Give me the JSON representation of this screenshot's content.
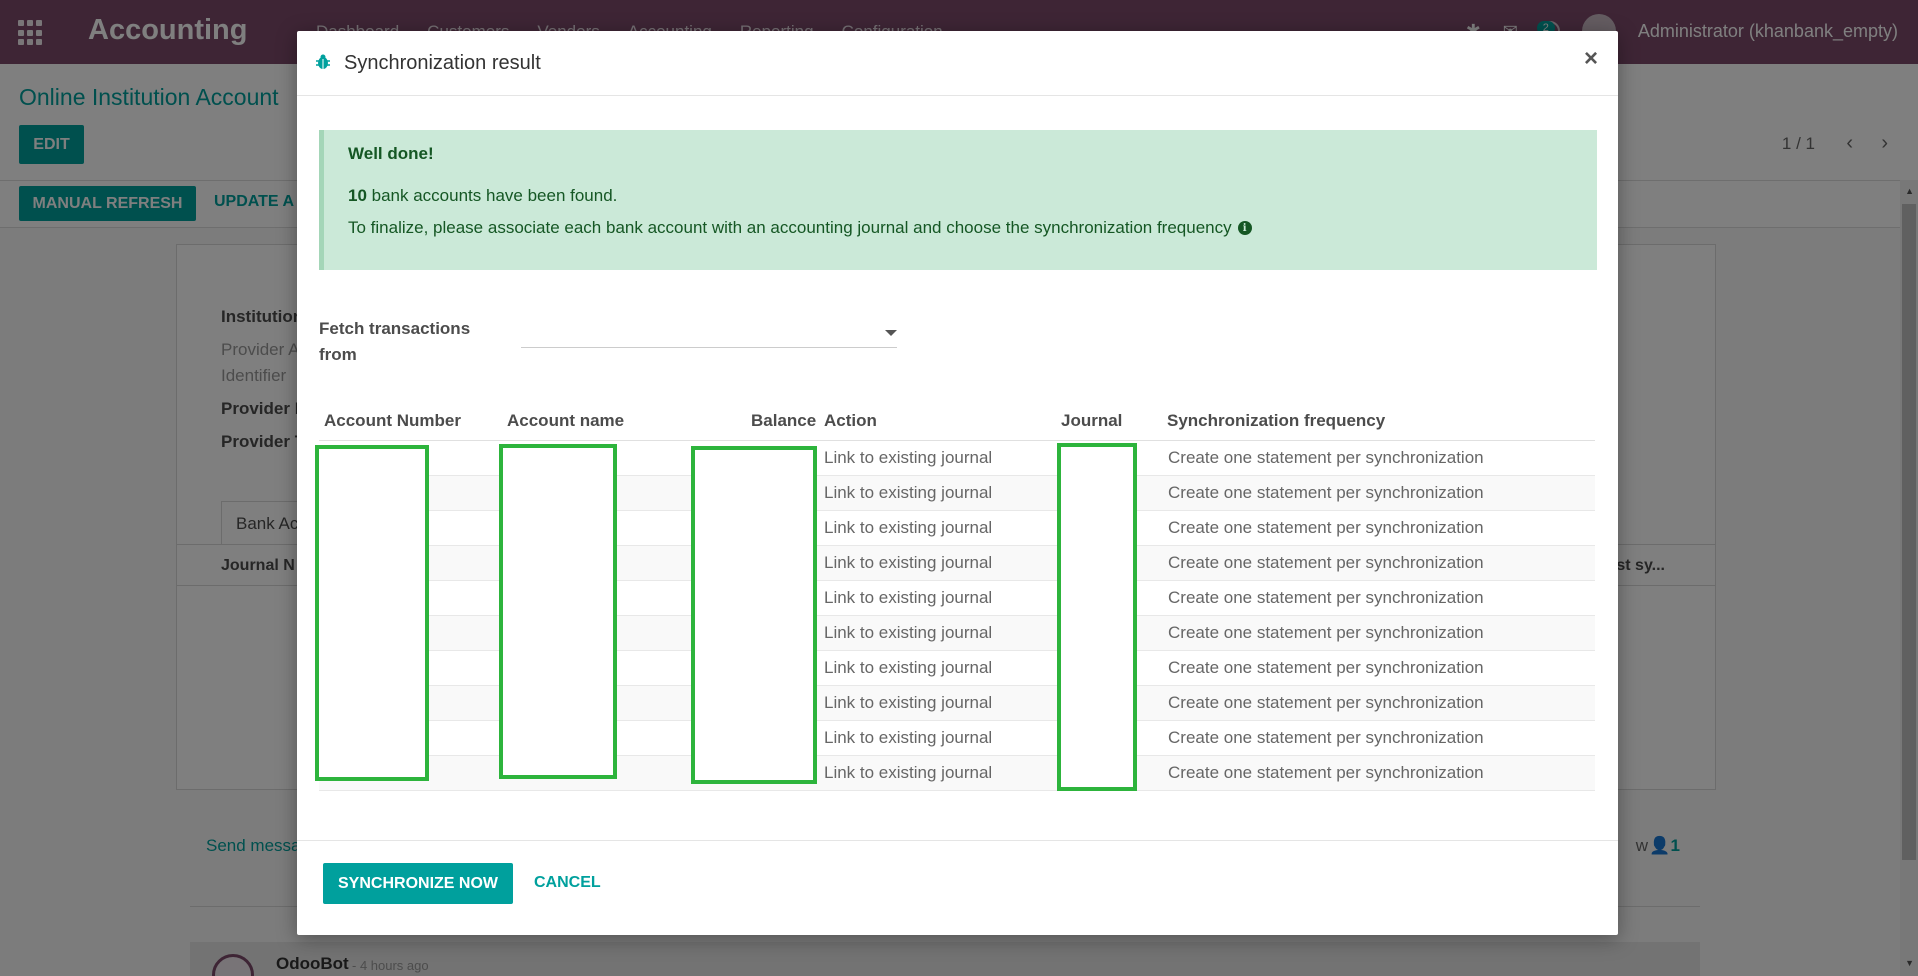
{
  "navbar": {
    "app_name": "Accounting",
    "menu": [
      "Dashboard",
      "Customers",
      "Vendors",
      "Accounting",
      "Reporting",
      "Configuration"
    ],
    "messages_badge": "2",
    "user": "Administrator (khanbank_empty)"
  },
  "control_panel": {
    "breadcrumb": "Online Institution Account",
    "edit_label": "EDIT",
    "pager": "1 / 1",
    "manual_refresh_label": "MANUAL REFRESH",
    "update_label": "UPDATE A"
  },
  "sheet": {
    "fields": [
      "Institution",
      "Provider A",
      "Identifier",
      "Provider I",
      "Provider T"
    ],
    "tab": "Bank Ac",
    "col_journal": "Journal N",
    "col_last_sync": "st sy..."
  },
  "chatter": {
    "send_message": "Send messa",
    "follow": "w",
    "followers_count": "1",
    "author": "OdooBot",
    "time": "- 4 hours ago"
  },
  "modal": {
    "title": "Synchronization result",
    "close_glyph": "×",
    "alert": {
      "title": "Well done!",
      "count": "10",
      "found_text": " bank accounts have been found.",
      "finalize_text": "To finalize, please associate each bank account with an accounting journal and choose the synchronization frequency"
    },
    "fetch_label": "Fetch transactions from",
    "fetch_value": "",
    "table": {
      "headers": {
        "account_number": "Account Number",
        "account_name": "Account name",
        "balance": "Balance",
        "action": "Action",
        "journal": "Journal",
        "sync_frequency": "Synchronization frequency"
      },
      "rows": [
        {
          "action": "Link to existing journal",
          "frequency": "Create one statement per synchronization"
        },
        {
          "action": "Link to existing journal",
          "frequency": "Create one statement per synchronization"
        },
        {
          "action": "Link to existing journal",
          "frequency": "Create one statement per synchronization"
        },
        {
          "action": "Link to existing journal",
          "frequency": "Create one statement per synchronization"
        },
        {
          "action": "Link to existing journal",
          "frequency": "Create one statement per synchronization"
        },
        {
          "action": "Link to existing journal",
          "frequency": "Create one statement per synchronization"
        },
        {
          "action": "Link to existing journal",
          "frequency": "Create one statement per synchronization"
        },
        {
          "action": "Link to existing journal",
          "frequency": "Create one statement per synchronization"
        },
        {
          "action": "Link to existing journal",
          "frequency": "Create one statement per synchronization"
        },
        {
          "action": "Link to existing journal",
          "frequency": "Create one statement per synchronization"
        }
      ]
    },
    "footer": {
      "sync_label": "SYNCHRONIZE NOW",
      "cancel_label": "CANCEL"
    }
  },
  "colors": {
    "navbar": "#7c4a6b",
    "primary": "#00a09d",
    "alert_bg": "#cbe9d8",
    "alert_text": "#155724",
    "redaction_border": "#2db43c"
  }
}
